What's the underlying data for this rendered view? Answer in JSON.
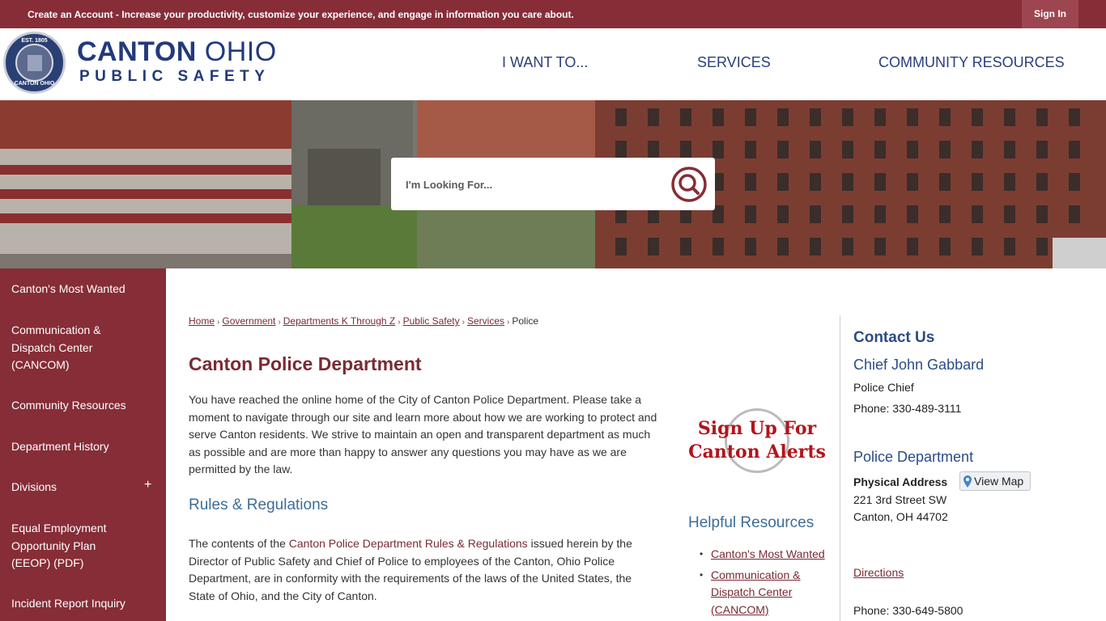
{
  "topbar": {
    "create_account": "Create an Account",
    "message": " - Increase your productivity, customize your experience, and engage in information you care about.",
    "sign_in": "Sign In"
  },
  "header": {
    "seal_top": "EST. 1805",
    "seal_bottom": "CANTON OHIO",
    "brand_bold": "CANTON",
    "brand_light": " OHIO",
    "brand_sub": "PUBLIC SAFETY",
    "nav": [
      "I WANT TO...",
      "SERVICES",
      "COMMUNITY RESOURCES"
    ]
  },
  "search": {
    "placeholder": "I'm Looking For..."
  },
  "sidebar": {
    "items": [
      "Canton's Most Wanted",
      "Communication & Dispatch Center (CANCOM)",
      "Community Resources",
      "Department History",
      "Divisions",
      "Equal Employment Opportunity Plan (EEOP) (PDF)",
      "Incident Report Inquiry"
    ],
    "expand": "+"
  },
  "breadcrumb": [
    "Home",
    "Government",
    "Departments K Through Z",
    "Public Safety",
    "Services",
    "Police"
  ],
  "breadcrumb_sep": "›",
  "main": {
    "title": "Canton Police Department",
    "intro": "You have reached the online home of the City of Canton Police Department. Please take a moment to navigate through our site and learn more about how we are working to protect and serve Canton residents. We strive to maintain an open and transparent department as much as possible and are more than happy to answer any questions you may have as we are permitted by the law.",
    "rules_heading": "Rules & Regulations",
    "rules_pre": "The contents of the ",
    "rules_link": "Canton Police Department Rules & Regulations",
    "rules_post": " issued herein by the Director of Public Safety and Chief of Police to employees of the Canton, Ohio Police Department, are in conformity with the requirements of the laws of the United States, the State of Ohio, and the City of Canton."
  },
  "alert": {
    "line1": "Sign Up For",
    "line2": "Canton Alerts"
  },
  "helpful": {
    "title": "Helpful Resources",
    "links": [
      "Canton's Most Wanted",
      "Communication & Dispatch Center (CANCOM)"
    ]
  },
  "contact": {
    "title": "Contact Us",
    "name": "Chief John Gabbard",
    "role": "Police Chief",
    "phone1": "Phone: 330-489-3111",
    "dept": "Police Department",
    "addr_label": "Physical Address",
    "view_map": "View Map",
    "addr1": "221 3rd Street SW",
    "addr2": "Canton, OH 44702",
    "directions": "Directions",
    "phone2": "Phone: 330-649-5800"
  },
  "colors": {
    "maroon": "#862d37",
    "navy": "#233a7a",
    "blue_heading": "#3d6d98"
  }
}
